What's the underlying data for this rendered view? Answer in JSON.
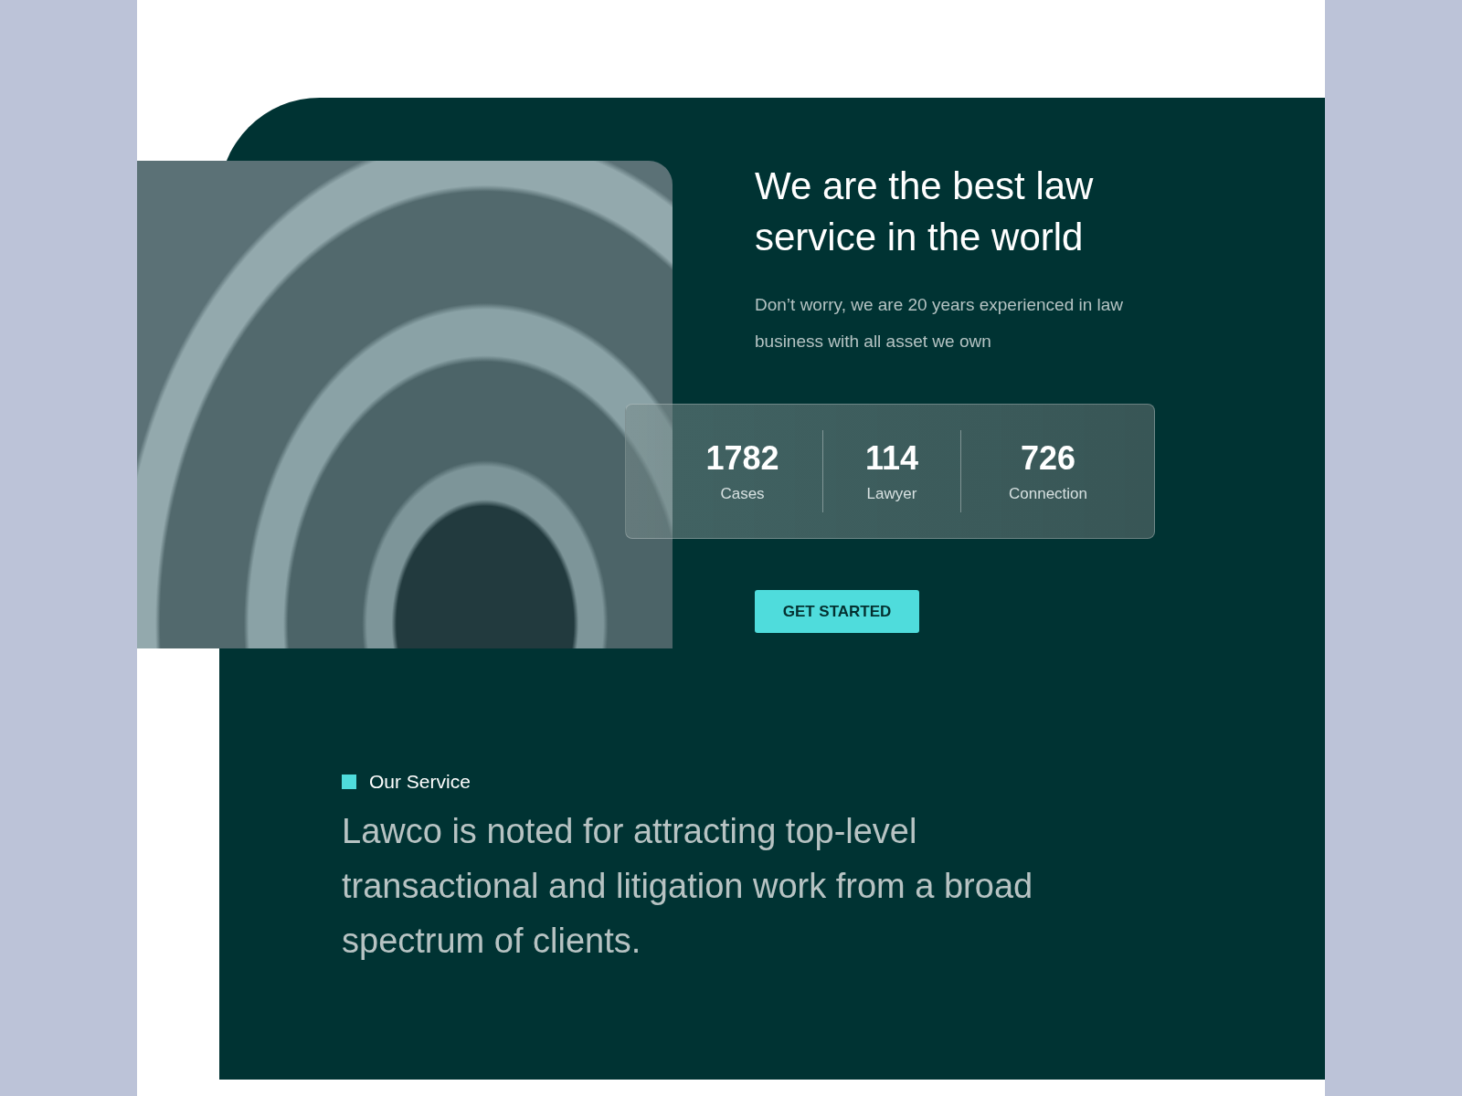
{
  "hero": {
    "title": "We are the best law service in the world",
    "description": "Don’t worry, we are 20 years experienced in law business with all asset we own",
    "stats": [
      {
        "value": "1782",
        "label": "Cases"
      },
      {
        "value": "114",
        "label": "Lawyer"
      },
      {
        "value": "726",
        "label": "Connection"
      }
    ],
    "button": "GET STARTED"
  },
  "service": {
    "label": "Our Service",
    "text": "Lawco is noted for attracting top-level transactional and litigation work from a broad spectrum of clients."
  }
}
